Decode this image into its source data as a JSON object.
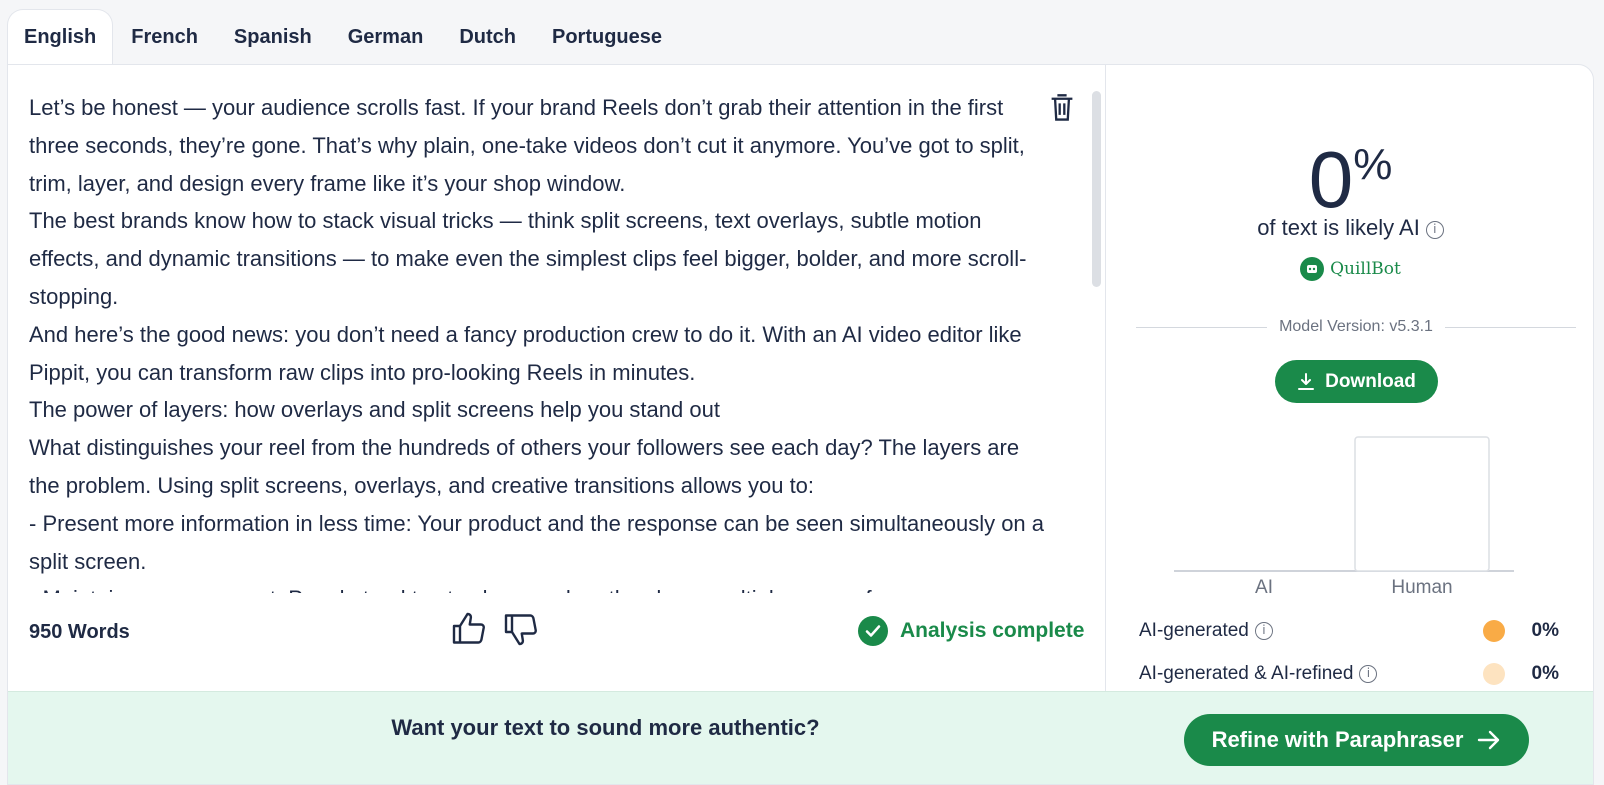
{
  "tabs": [
    {
      "label": "English",
      "active": true
    },
    {
      "label": "French"
    },
    {
      "label": "Spanish"
    },
    {
      "label": "German"
    },
    {
      "label": "Dutch"
    },
    {
      "label": "Portuguese"
    }
  ],
  "editor": {
    "paragraphs": [
      "Let’s be honest — your audience scrolls fast. If your brand Reels don’t grab their attention in the first three seconds, they’re gone. That’s why plain, one-take videos don’t cut it anymore. You’ve got to split, trim, layer, and design every frame like it’s your shop window.",
      "The best brands know how to stack visual tricks — think split screens, text overlays, subtle motion effects, and dynamic transitions — to make even the simplest clips feel bigger, bolder, and more scroll-stopping.",
      "And here’s the good news: you don’t need a fancy production crew to do it. With an AI video editor like Pippit, you can transform raw clips into pro-looking Reels in minutes.",
      "The power of layers: how overlays and split screens help you stand out",
      "What distinguishes your reel from the hundreds of others your followers see each day? The layers are the problem. Using split screens, overlays, and creative transitions allows you to:",
      "- Present more information in less time: Your product and the response can be seen simultaneously on a split screen.",
      "- Maintain eye movement: People tend to stay longer when they have multiple areas of"
    ],
    "word_count": "950 Words",
    "status": "Analysis complete"
  },
  "result": {
    "percent": "0",
    "percent_sign": "%",
    "label": "of text is likely AI",
    "brand": "QuillBot",
    "model_version": "Model Version: v5.3.1",
    "download_label": "Download"
  },
  "chart_data": {
    "type": "bar",
    "categories": [
      "AI",
      "Human"
    ],
    "values": [
      0,
      100
    ],
    "ylim": [
      0,
      100
    ],
    "grid": false
  },
  "breakdown": [
    {
      "label": "AI-generated",
      "value": "0%",
      "color": "#f9ab46"
    },
    {
      "label": "AI-generated & AI-refined",
      "value": "0%",
      "color": "#fde3c0"
    }
  ],
  "banner": {
    "text": "Want your text to sound more authentic?",
    "button_label": "Refine with Paraphraser"
  },
  "colors": {
    "accent": "#1a8a4a",
    "banner_bg": "#e4f7ee"
  }
}
